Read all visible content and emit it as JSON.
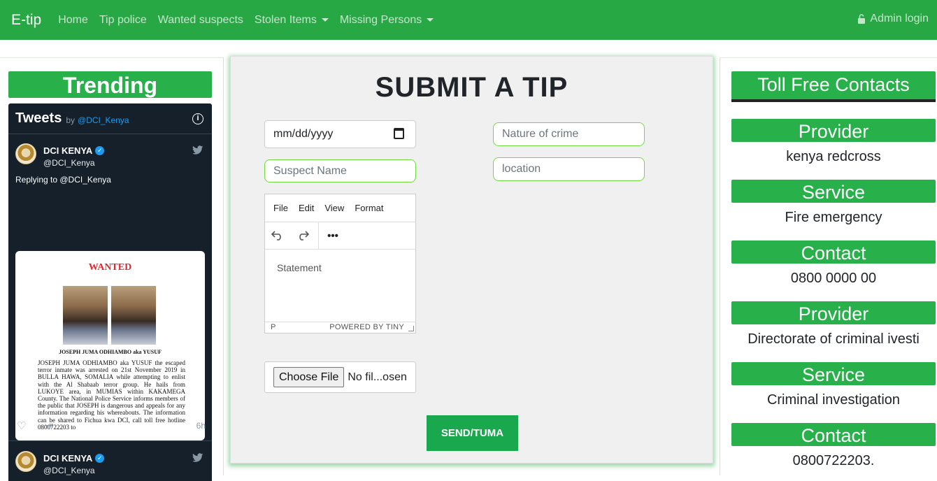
{
  "navbar": {
    "brand": "E-tip",
    "links": [
      "Home",
      "Tip police",
      "Wanted suspects"
    ],
    "dropdowns": [
      "Stolen Items",
      "Missing Persons"
    ],
    "admin": "Admin login",
    "color": "#28a745"
  },
  "trending": {
    "title": "Trending",
    "widget": {
      "title": "Tweets",
      "by": "by",
      "handle": "@DCI_Kenya",
      "tweets": [
        {
          "name": "DCI KENYA",
          "user": "@DCI_Kenya",
          "reply": "Replying to @DCI_Kenya",
          "time": "6h"
        },
        {
          "name": "DCI KENYA",
          "user": "@DCI_Kenya"
        }
      ],
      "poster": {
        "heading": "WANTED",
        "name": "JOSEPH JUMA ODHIAMBO aka YUSUF",
        "body": "JOSEPH JUMA ODHIAMBO aka YUSUF the escaped terror inmate was arrested on 21st November 2019 in BULLA HAWA, SOMALIA while attempting to enlist with the Al Shabaab terror group. He hails from LUKOYE area, in MUMIAS within KAKAMEGA County. The National Police Service informs members of the public that JOSEPH is dangerous and appeals for any information regarding his whereabouts. The information can be shared to Fichua kwa DCI, call toll free hotline 0800722203 to"
      }
    }
  },
  "form": {
    "title": "SUBMIT A TIP",
    "date_placeholder": "mm/dd/yyyy",
    "suspect_placeholder": "Suspect Name",
    "nature_placeholder": "Nature of crime",
    "location_placeholder": "location",
    "editor": {
      "menu": [
        "File",
        "Edit",
        "View",
        "Format"
      ],
      "placeholder": "Statement",
      "status": "P",
      "powered": "POWERED BY TINY"
    },
    "file_button": "Choose File",
    "file_label": "No fil...osen",
    "submit": "SEND/TUMA"
  },
  "contacts": {
    "title": "Toll Free Contacts",
    "entries": [
      {
        "label": "Provider",
        "value": "kenya redcross"
      },
      {
        "label": "Service",
        "value": "Fire emergency"
      },
      {
        "label": "Contact",
        "value": "0800 0000 00"
      },
      {
        "label": "Provider",
        "value": "Directorate of criminal ivesti"
      },
      {
        "label": "Service",
        "value": "Criminal investigation"
      },
      {
        "label": "Contact",
        "value": "0800722203."
      }
    ]
  }
}
